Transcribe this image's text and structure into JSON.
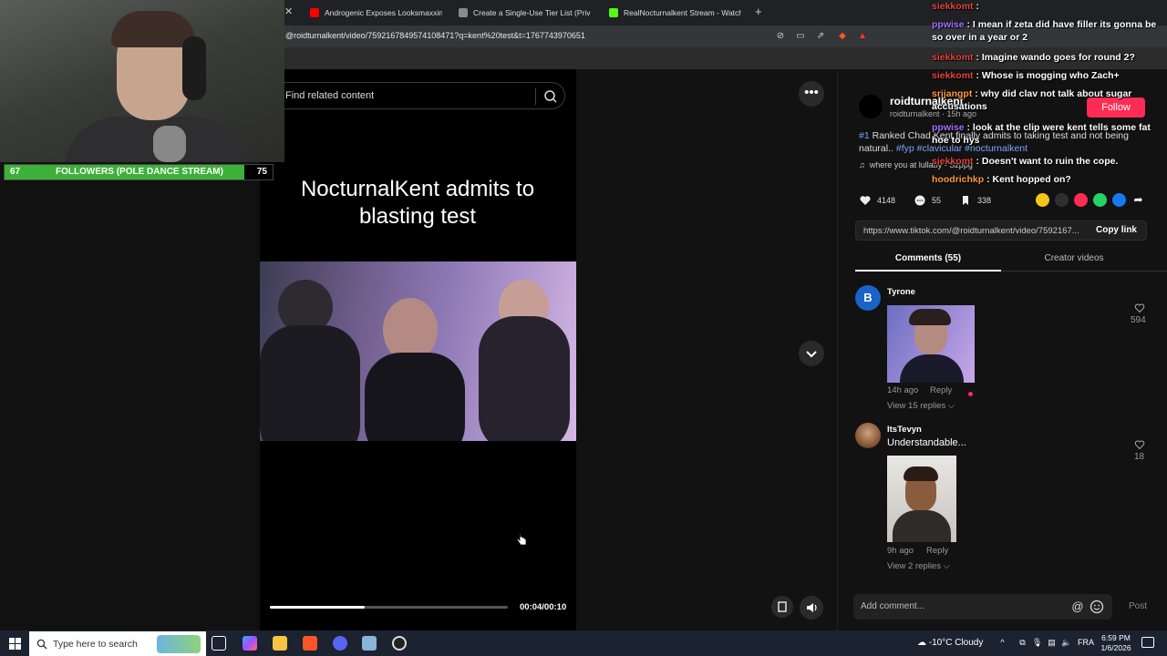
{
  "browser": {
    "tabs": [
      {
        "label": "Androgenic Exposes Looksmaxxing!",
        "favicon_color": "#ff0000"
      },
      {
        "label": "Create a Single-Use Tier List (Private",
        "favicon_color": "#8a8a8a"
      },
      {
        "label": "RealNocturnalkent Stream - Watch Li",
        "favicon_color": "#53fc18"
      }
    ],
    "url": "@roidturnalkent/video/7592167849574108471?q=kent%20test&t=1767743970651"
  },
  "stream_overlay": {
    "goal": {
      "current": "67",
      "title": "FOLLOWERS (POLE DANCE STREAM)",
      "target": "75",
      "fraction": 0.893,
      "color": "#3db03a"
    }
  },
  "video": {
    "search_placeholder": "Find related content",
    "title": "NocturnalKent admits to blasting test",
    "time": "00:04/00:10",
    "progress": 0.4
  },
  "post": {
    "creator": "roidturnalkent",
    "creator_sub": "roidturnalkent · 15h ago",
    "follow_label": "Follow",
    "caption_plain": "Ranked Chad Kent finally admits to taking test and not being natural..",
    "caption_tag1": "#1",
    "caption_tags": "#fyp #clavicular #nocturnalkent",
    "music": "where you at lullaby - Szppg",
    "likes": "4148",
    "comments": "55",
    "saves": "338",
    "link": "https://www.tiktok.com/@roidturnalkent/video/7592167...",
    "copy_label": "Copy link",
    "tab_comments": "Comments (55)",
    "tab_creator": "Creator videos"
  },
  "comments": [
    {
      "avatar_letter": "B",
      "user": "Tyrone",
      "time": "14h ago",
      "reply": "Reply",
      "view_replies": "View 15 replies",
      "likes": "594"
    },
    {
      "user": "ItsTevyn",
      "text": "Understandable...",
      "time": "9h ago",
      "reply": "Reply",
      "view_replies": "View 2 replies",
      "likes": "18"
    }
  ],
  "comment_input": {
    "placeholder": "Add comment...",
    "post_label": "Post"
  },
  "chat": [
    {
      "user": "siekkomt",
      "text": "",
      "color": "#e2453c"
    },
    {
      "user": "ppwise",
      "text": "I mean if zeta did have filler its gonna be so over in a year or 2",
      "color": "#a970ff"
    },
    {
      "user": "siekkomt",
      "text": "Imagine wando goes for round 2?",
      "color": "#e2453c"
    },
    {
      "user": "siekkomt",
      "text": "Whose is mogging who Zach+",
      "color": "#e2453c"
    },
    {
      "user": "srijangpt",
      "text": "why did clav not talk about sugar accusations",
      "color": "#ff9a3c"
    },
    {
      "user": "ppwise",
      "text": "look at the clip were kent tells some fat hoe to hys",
      "color": "#a970ff"
    },
    {
      "user": "siekkomt",
      "text": "Doesn't want to ruin the cope.",
      "color": "#e2453c"
    },
    {
      "user": "hoodrichkp",
      "text": "Kent hopped on?",
      "color": "#ff9a3c"
    }
  ],
  "taskbar": {
    "search_placeholder": "Type here to search",
    "weather": "-10°C  Cloudy",
    "lang": "FRA",
    "time": "6:59 PM",
    "date": "1/6/2026"
  }
}
